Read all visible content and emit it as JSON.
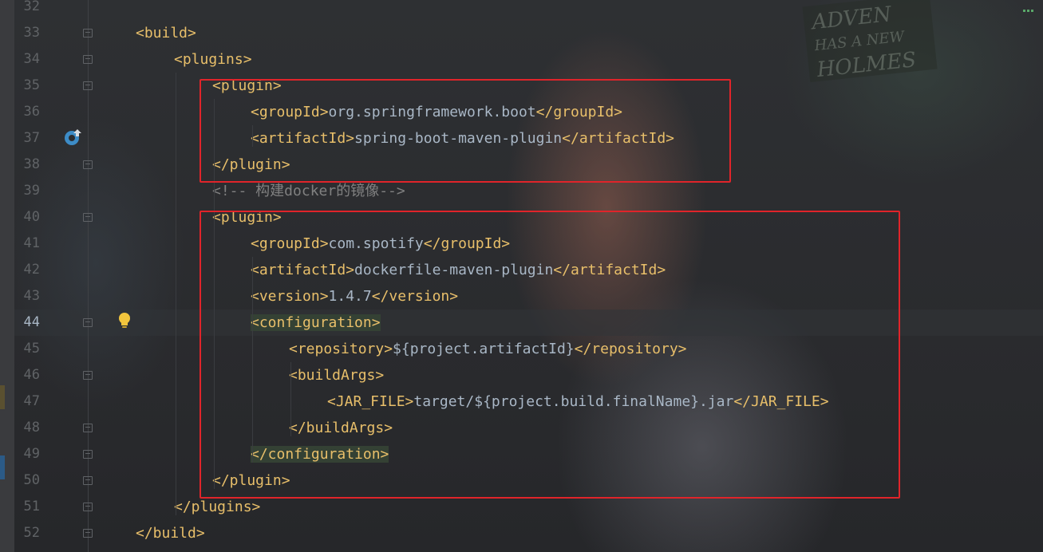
{
  "background": {
    "poster_text": [
      "ADVEN",
      "HAS A NEW",
      "HOLMES"
    ]
  },
  "colors": {
    "tag": "#e8bf6a",
    "text": "#a9b7c6",
    "comment": "#808080",
    "line_number": "#606366",
    "highlight": "#344134",
    "annotation_box": "#e0242a"
  },
  "editor": {
    "active_line": "44",
    "lines": [
      {
        "num": "32",
        "indent": 0,
        "tokens": []
      },
      {
        "num": "33",
        "indent": 0,
        "tokens": [
          {
            "t": "<build>",
            "c": "tag"
          }
        ]
      },
      {
        "num": "34",
        "indent": 1,
        "tokens": [
          {
            "t": "<plugins>",
            "c": "tag"
          }
        ]
      },
      {
        "num": "35",
        "indent": 2,
        "tokens": [
          {
            "t": "<plugin>",
            "c": "tag"
          }
        ]
      },
      {
        "num": "36",
        "indent": 3,
        "tokens": [
          {
            "t": "<groupId>",
            "c": "tag"
          },
          {
            "t": "org.springframework.boot",
            "c": "txt"
          },
          {
            "t": "</groupId>",
            "c": "tag"
          }
        ]
      },
      {
        "num": "37",
        "indent": 3,
        "tokens": [
          {
            "t": "<artifactId>",
            "c": "tag"
          },
          {
            "t": "spring-boot-maven-plugin",
            "c": "txt"
          },
          {
            "t": "</artifactId>",
            "c": "tag"
          }
        ]
      },
      {
        "num": "38",
        "indent": 2,
        "tokens": [
          {
            "t": "</plugin>",
            "c": "tag"
          }
        ]
      },
      {
        "num": "39",
        "indent": 2,
        "tokens": [
          {
            "t": "<!-- 构建docker的镜像-->",
            "c": "cmt"
          }
        ]
      },
      {
        "num": "40",
        "indent": 2,
        "tokens": [
          {
            "t": "<plugin>",
            "c": "tag"
          }
        ]
      },
      {
        "num": "41",
        "indent": 3,
        "tokens": [
          {
            "t": "<groupId>",
            "c": "tag"
          },
          {
            "t": "com.spotify",
            "c": "txt"
          },
          {
            "t": "</groupId>",
            "c": "tag"
          }
        ]
      },
      {
        "num": "42",
        "indent": 3,
        "tokens": [
          {
            "t": "<artifactId>",
            "c": "tag"
          },
          {
            "t": "dockerfile-maven-plugin",
            "c": "txt"
          },
          {
            "t": "</artifactId>",
            "c": "tag"
          }
        ]
      },
      {
        "num": "43",
        "indent": 3,
        "tokens": [
          {
            "t": "<version>",
            "c": "tag"
          },
          {
            "t": "1.4.7",
            "c": "txt"
          },
          {
            "t": "</version>",
            "c": "tag"
          }
        ]
      },
      {
        "num": "44",
        "indent": 3,
        "tokens": [
          {
            "t": "<configuration>",
            "c": "tag hl"
          }
        ]
      },
      {
        "num": "45",
        "indent": 4,
        "tokens": [
          {
            "t": "<repository>",
            "c": "tag"
          },
          {
            "t": "${project.artifactId}",
            "c": "txt"
          },
          {
            "t": "</repository>",
            "c": "tag"
          }
        ]
      },
      {
        "num": "46",
        "indent": 4,
        "tokens": [
          {
            "t": "<buildArgs>",
            "c": "tag"
          }
        ]
      },
      {
        "num": "47",
        "indent": 5,
        "tokens": [
          {
            "t": "<JAR_FILE>",
            "c": "tag"
          },
          {
            "t": "target/${project.build.finalName}.jar",
            "c": "txt"
          },
          {
            "t": "</JAR_FILE>",
            "c": "tag"
          }
        ]
      },
      {
        "num": "48",
        "indent": 4,
        "tokens": [
          {
            "t": "</buildArgs>",
            "c": "tag"
          }
        ]
      },
      {
        "num": "49",
        "indent": 3,
        "tokens": [
          {
            "t": "</configuration>",
            "c": "tag hl"
          }
        ]
      },
      {
        "num": "50",
        "indent": 2,
        "tokens": [
          {
            "t": "</plugin>",
            "c": "tag"
          }
        ]
      },
      {
        "num": "51",
        "indent": 1,
        "tokens": [
          {
            "t": "</plugins>",
            "c": "tag"
          }
        ]
      },
      {
        "num": "52",
        "indent": 0,
        "tokens": [
          {
            "t": "</build>",
            "c": "tag"
          }
        ]
      }
    ],
    "fold_markers": [
      "33",
      "34",
      "35",
      "38",
      "40",
      "44",
      "46",
      "48",
      "49",
      "50",
      "51",
      "52"
    ],
    "gutter_icons": {
      "run_line": "37",
      "bulb_line": "44"
    }
  },
  "annotations": [
    {
      "name": "spring-boot-plugin-box",
      "from_line": "35",
      "to_line": "38"
    },
    {
      "name": "dockerfile-plugin-box",
      "from_line": "40",
      "to_line": "50"
    }
  ]
}
